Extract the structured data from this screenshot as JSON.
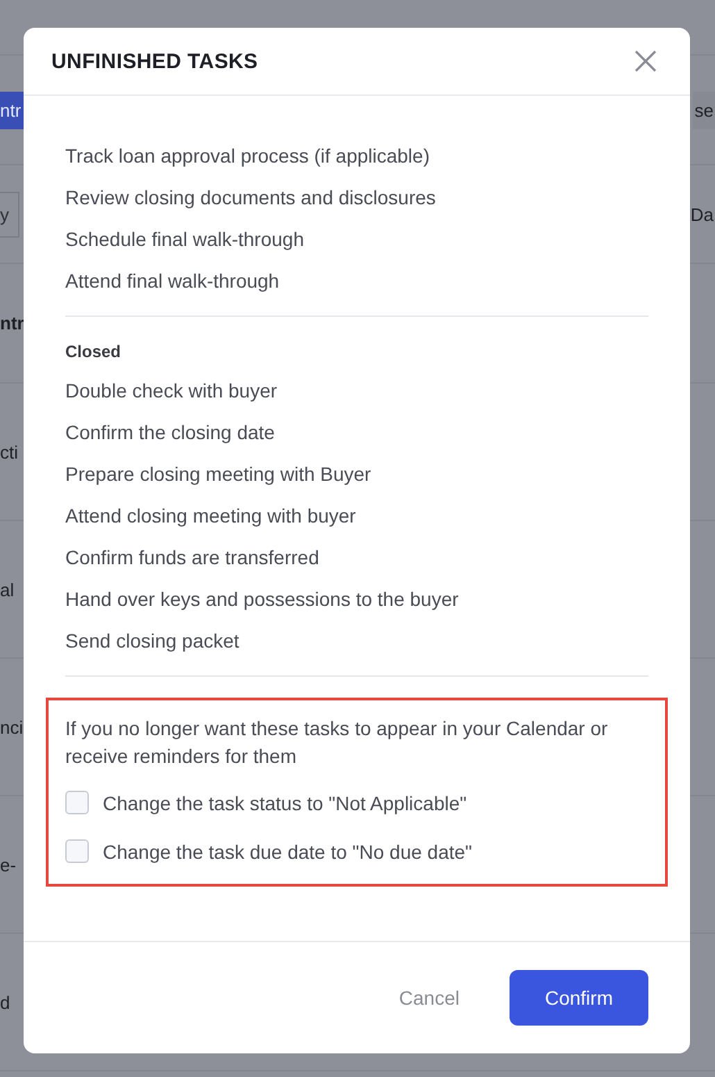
{
  "background": {
    "rows": [
      {
        "kind": "button",
        "left": "ntr",
        "right": "se"
      },
      {
        "kind": "field",
        "left": "y",
        "right": "Da"
      },
      {
        "kind": "header",
        "left": "ntr"
      },
      {
        "kind": "row",
        "left": "cti"
      },
      {
        "kind": "row",
        "left": "al"
      },
      {
        "kind": "row",
        "left": "nci"
      },
      {
        "kind": "row",
        "left": "e-"
      },
      {
        "kind": "row",
        "left": "d"
      }
    ]
  },
  "dialog": {
    "title": "UNFINISHED TASKS",
    "groups": [
      {
        "tasks": [
          "Track loan approval process (if applicable)",
          "Review closing documents and disclosures",
          "Schedule final walk-through",
          "Attend final walk-through"
        ]
      },
      {
        "heading": "Closed",
        "tasks": [
          "Double check with buyer",
          "Confirm the closing date",
          "Prepare closing meeting with Buyer",
          "Attend closing meeting with buyer",
          "Confirm funds are transferred",
          "Hand over keys and possessions to the buyer",
          "Send closing packet"
        ]
      }
    ],
    "note": "If you no longer want these tasks to appear in your Calendar or receive reminders for them",
    "options": [
      {
        "label": "Change the task status to \"Not Applicable\"",
        "checked": false
      },
      {
        "label": "Change the task due date to \"No due date\"",
        "checked": false
      }
    ],
    "buttons": [
      {
        "label": "Cancel",
        "kind": "secondary"
      },
      {
        "label": "Confirm",
        "kind": "primary"
      }
    ]
  }
}
